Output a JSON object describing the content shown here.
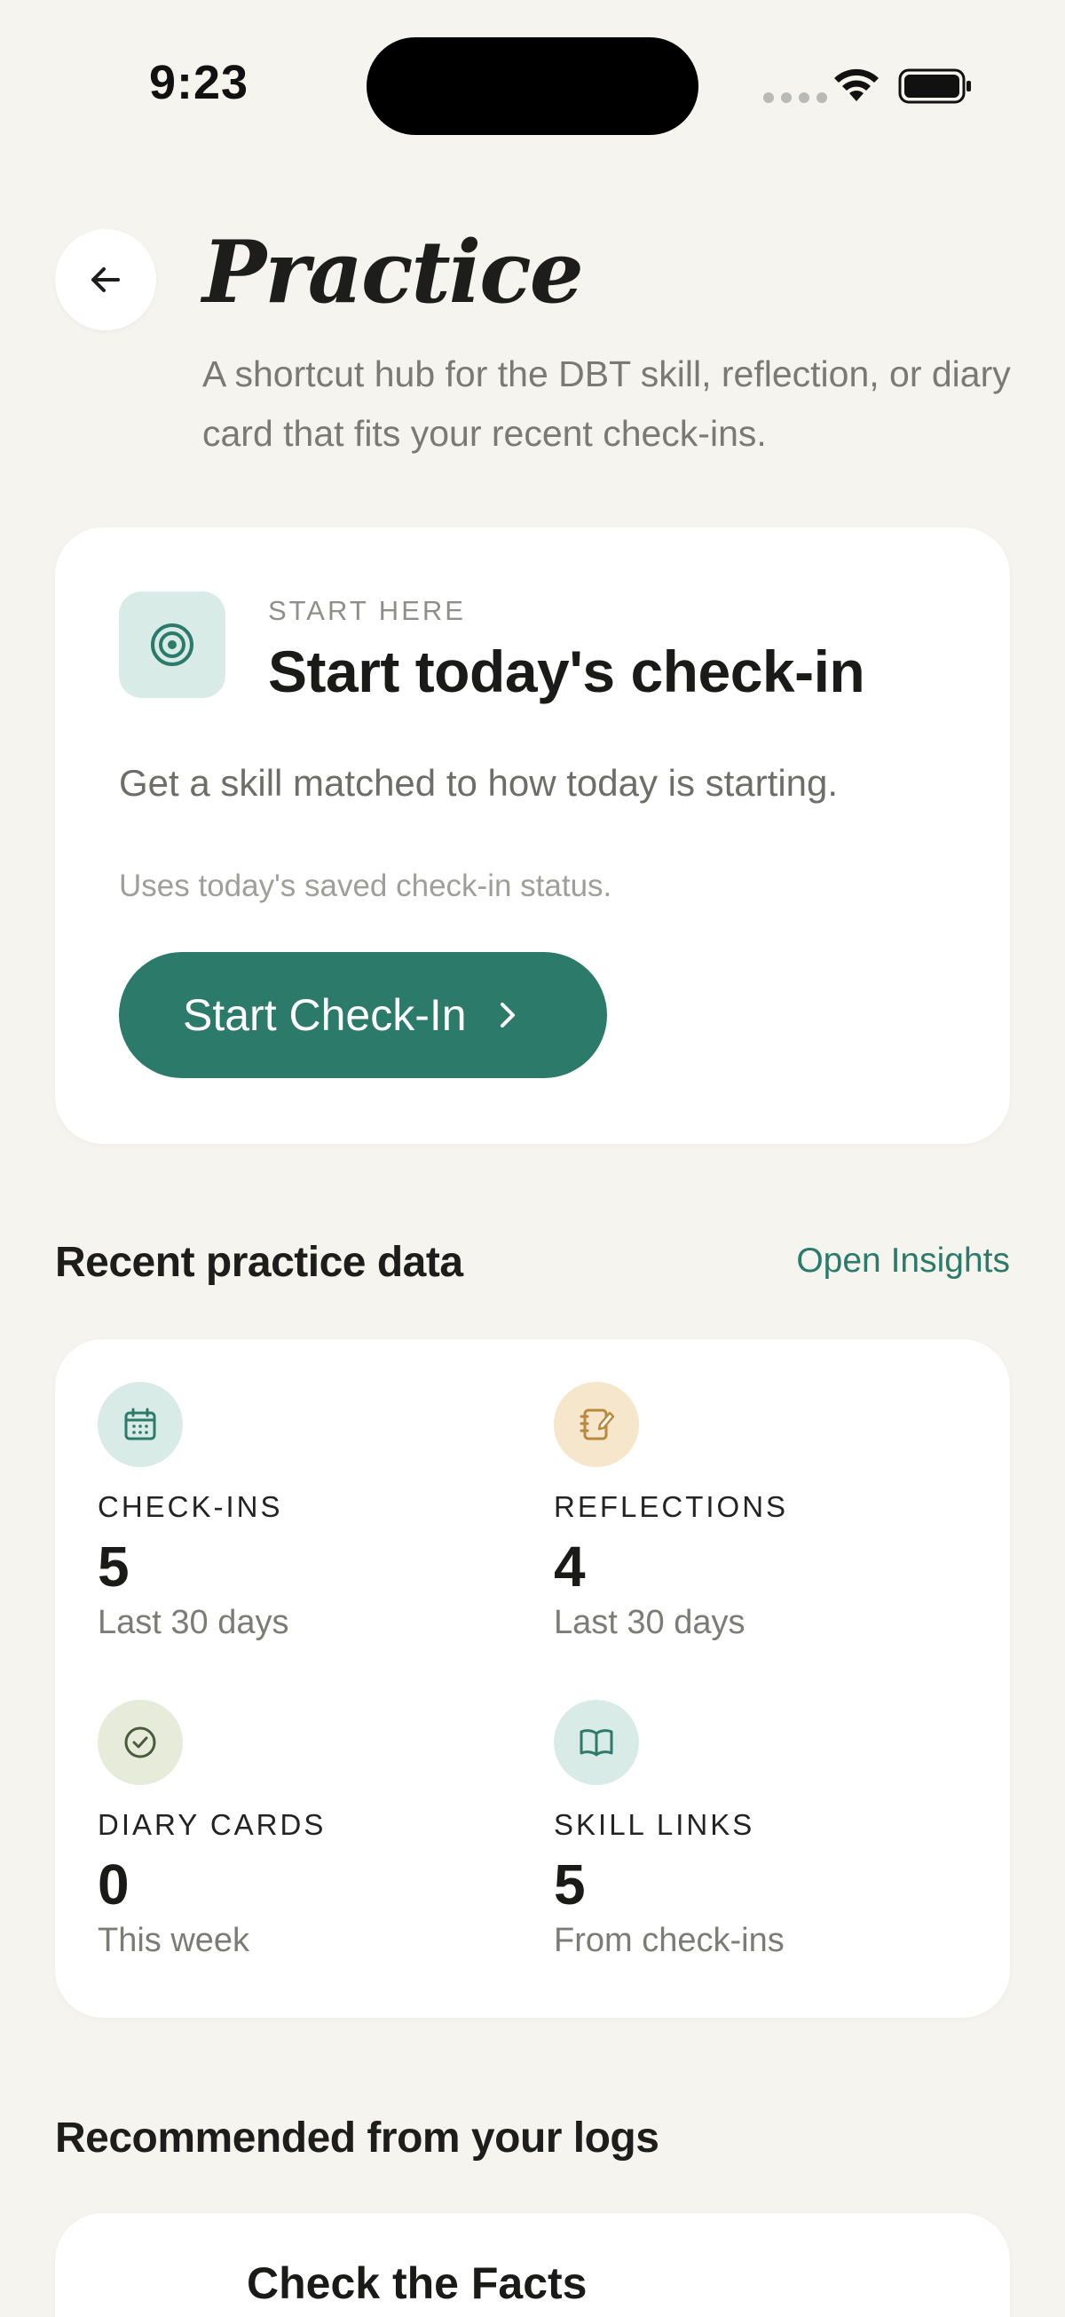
{
  "status_bar": {
    "time": "9:23"
  },
  "header": {
    "title": "Practice",
    "subtitle": "A shortcut hub for the DBT skill, reflection, or diary card that fits your recent check-ins."
  },
  "start_card": {
    "eyebrow": "START HERE",
    "title": "Start today's check-in",
    "description": "Get a skill matched to how today is starting.",
    "note": "Uses today's saved check-in status.",
    "button_label": "Start Check-In"
  },
  "recent": {
    "section_title": "Recent practice data",
    "link_label": "Open Insights",
    "stats": [
      {
        "label": "CHECK-INS",
        "value": "5",
        "caption": "Last 30 days",
        "icon": "calendar-icon",
        "tint": "#d8ebe7",
        "color": "#2b7a6a"
      },
      {
        "label": "REFLECTIONS",
        "value": "4",
        "caption": "Last 30 days",
        "icon": "notebook-pen-icon",
        "tint": "#f5e6cc",
        "color": "#b98a3e"
      },
      {
        "label": "DIARY CARDS",
        "value": "0",
        "caption": "This week",
        "icon": "check-circle-icon",
        "tint": "#e6ecd9",
        "color": "#4a5a3c"
      },
      {
        "label": "SKILL LINKS",
        "value": "5",
        "caption": "From check-ins",
        "icon": "book-open-icon",
        "tint": "#d8ebe7",
        "color": "#2b7a6a"
      }
    ]
  },
  "recommended": {
    "section_title": "Recommended from your logs",
    "first_item_title": "Check the Facts"
  },
  "colors": {
    "background": "#f6f4ee",
    "accent": "#2b7a6a",
    "card": "#ffffff"
  }
}
